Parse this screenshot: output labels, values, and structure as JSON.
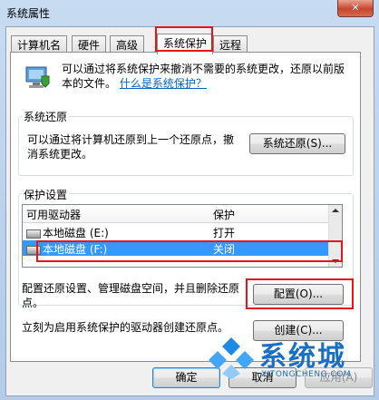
{
  "window": {
    "title": "系统属性",
    "close_glyph": "✕"
  },
  "tabs": [
    {
      "label": "计算机名"
    },
    {
      "label": "硬件"
    },
    {
      "label": "高级"
    },
    {
      "label": "系统保护"
    },
    {
      "label": "远程"
    }
  ],
  "intro": {
    "text": "可以通过将系统保护来撤消不需要的系统更改，还原以前版本的文件。",
    "link": "什么是系统保护？"
  },
  "restore": {
    "group_label": "系统还原",
    "text": "可以通过将计算机还原到上一个还原点，撤消系统更改。",
    "button": "系统还原(S)..."
  },
  "protection": {
    "group_label": "保护设置",
    "columns": [
      "可用驱动器",
      "保护"
    ],
    "rows": [
      {
        "drive": "本地磁盘 (E:)",
        "status": "打开"
      },
      {
        "drive": "本地磁盘 (F:)",
        "status": "关闭"
      }
    ],
    "config_text": "配置还原设置、管理磁盘空间，并且删除还原点。",
    "config_button": "配置(O)...",
    "create_text": "立刻为启用系统保护的驱动器创建还原点。",
    "create_button": "创建(C)..."
  },
  "footer": {
    "ok": "确定",
    "cancel": "取消",
    "apply": "应用(A)"
  },
  "watermark": {
    "brand": "系统城",
    "url": "XITONGCHENG.COM"
  },
  "colors": {
    "highlight": "#e8141b",
    "selection": "#3399ff",
    "link": "#0066cc"
  }
}
